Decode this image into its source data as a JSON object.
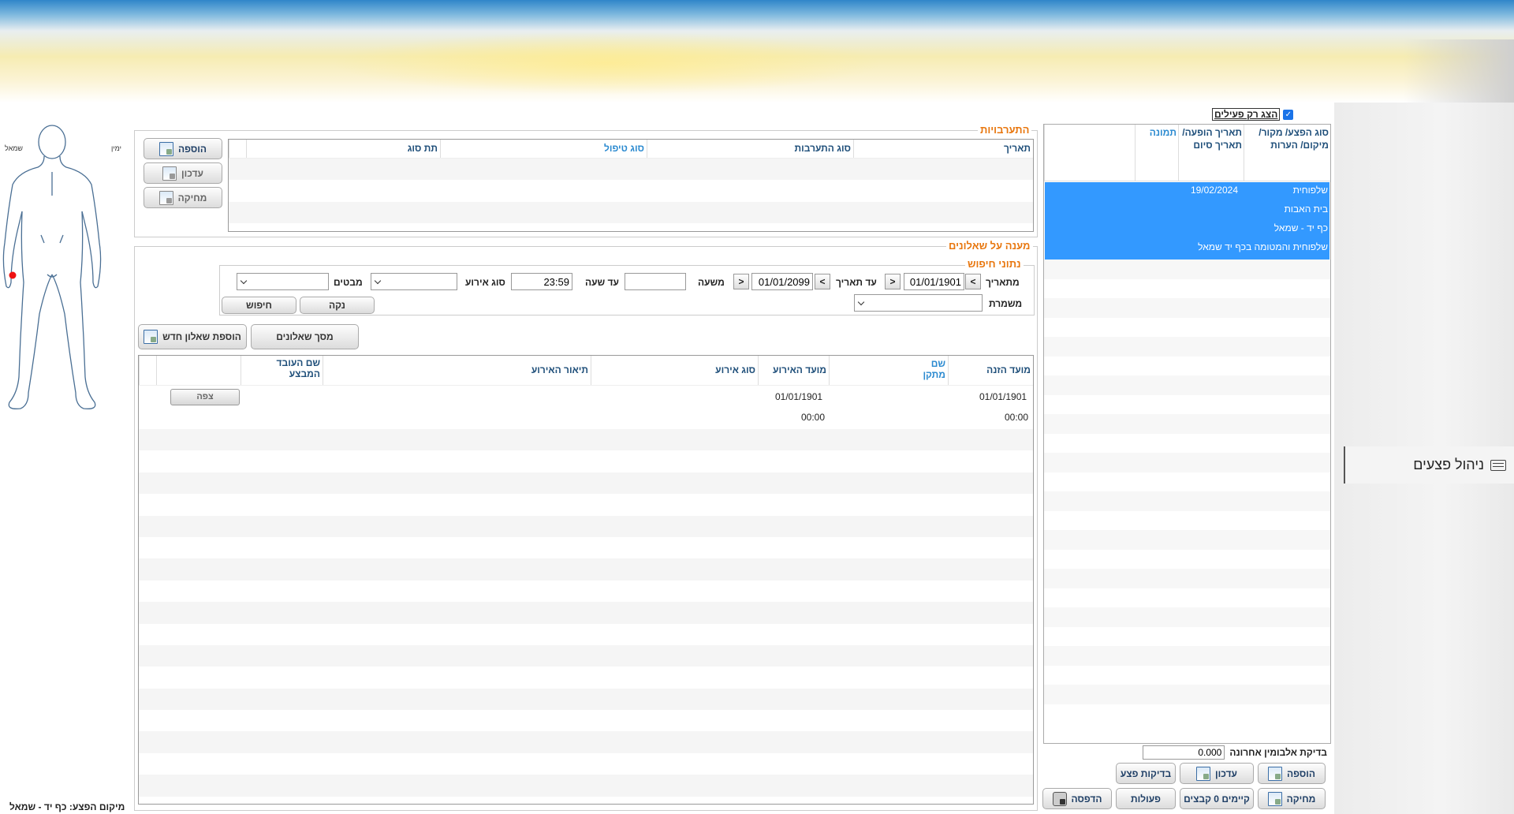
{
  "banner": {},
  "nav": {
    "wound_mgmt_label": "ניהול פצעים"
  },
  "wound_list": {
    "only_active_label": "הצג רק פעילים",
    "only_active_checked": true,
    "columns": {
      "type": "סוג הפצע/ מקור/ מיקום/ הערות",
      "dates": "תאריך הופעה/ תאריך סיום",
      "photo": "תמונה"
    },
    "selected": {
      "type": "שלפוחית",
      "date": "19/02/2024",
      "source": "בית האבות",
      "location": "כף יד - שמאל",
      "notes": "שלפוחית והמטומה בכף יד שמאל"
    },
    "albumin_label": "בדיקת אלבומין אחרונה",
    "albumin_value": "0.000",
    "buttons": {
      "add": "הוספה",
      "update": "עדכון",
      "tests": "בדיקות פצע",
      "delete": "מחיקה",
      "files": "קיימים 0 קבצים",
      "actions": "פעולות",
      "print": "הדפסה"
    }
  },
  "figure": {
    "right_label": "ימין",
    "left_label": "שמאל",
    "location_text": "מיקום הפצע: כף יד - שמאל"
  },
  "interventions": {
    "title": "התערבויות",
    "columns": {
      "date": "תאריך",
      "type": "סוג התערבות",
      "treatment": "סוג טיפול",
      "subtype": "תת סוג"
    },
    "buttons": {
      "add": "הוספה",
      "update": "עדכון",
      "delete": "מחיקה"
    }
  },
  "questionnaires": {
    "title": "מענה על שאלונים",
    "search_title": "נתוני חיפוש",
    "from_date_label": "מתאריך",
    "from_date": "01/01/1901",
    "to_date_label": "עד תאריך",
    "to_date": "01/01/2099",
    "from_time_label": "משעה",
    "from_time": "",
    "to_time_label": "עד שעה",
    "to_time": "23:59",
    "event_type_label": "סוג אירוע",
    "performers_label": "מבטים",
    "shift_label": "משמרת",
    "clear_button": "נקה",
    "search_button": "חיפוש",
    "questionnaire_screen_button": "מסך שאלונים",
    "add_questionnaire_button": "הוספת שאלון חדש",
    "columns": {
      "entry_time": "מועד הזנה",
      "form_name": "שם מתקן",
      "event_time": "מועד האירוע",
      "event_type": "סוג אירוע",
      "event_desc": "תיאור האירוע",
      "performer": "שם העובד המבצע"
    },
    "rows": [
      {
        "entry_date": "01/01/1901",
        "entry_time": "00:00",
        "event_date": "01/01/1901",
        "event_time": "00:00",
        "view_label": "צפה"
      }
    ]
  }
}
